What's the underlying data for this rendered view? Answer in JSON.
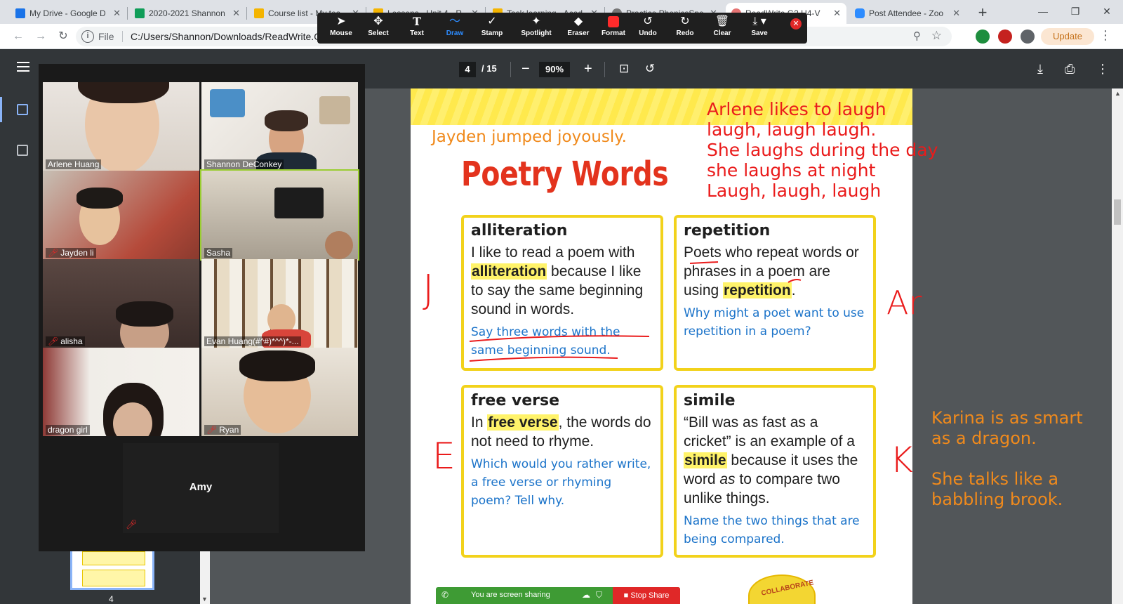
{
  "browser": {
    "tabs": [
      {
        "label": "My Drive - Google D",
        "favicon_color": "#1a73e8"
      },
      {
        "label": "2020-2021 Shannon",
        "favicon_color": "#0f9d58"
      },
      {
        "label": "Course list - My tea",
        "favicon_color": "#f4b400"
      },
      {
        "label": "Lessons - Unit 4 - R",
        "favicon_color": "#f4b400"
      },
      {
        "label": "Task learning - Acad",
        "favicon_color": "#f4b400"
      },
      {
        "label": "Practice PhonicsSpe",
        "favicon_color": "#777777"
      },
      {
        "label": "ReadWrite G2 U4-V",
        "favicon_color": "#e57373"
      },
      {
        "label": "Post Attendee - Zoo",
        "favicon_color": "#2d8cff"
      }
    ],
    "active_tab_index": 6,
    "url": "C:/Users/Shannon/Downloads/ReadWrite.G2.U4.V",
    "file_label": "File",
    "update_label": "Update"
  },
  "annotation_toolbar": {
    "tools": [
      {
        "label": "Mouse",
        "icon": "cursor-icon"
      },
      {
        "label": "Select",
        "icon": "move-icon"
      },
      {
        "label": "Text",
        "icon": "text-icon"
      },
      {
        "label": "Draw",
        "icon": "draw-icon"
      },
      {
        "label": "Stamp",
        "icon": "stamp-icon"
      },
      {
        "label": "Spotlight",
        "icon": "spotlight-icon"
      },
      {
        "label": "Eraser",
        "icon": "eraser-icon"
      },
      {
        "label": "Format",
        "icon": "format-icon"
      },
      {
        "label": "Undo",
        "icon": "undo-icon"
      },
      {
        "label": "Redo",
        "icon": "redo-icon"
      },
      {
        "label": "Clear",
        "icon": "trash-icon"
      },
      {
        "label": "Save",
        "icon": "save-icon"
      }
    ],
    "selected": "Draw",
    "accent": "#2d8cff"
  },
  "pdf_viewer": {
    "current_page": "4",
    "total_pages": "/ 15",
    "zoom": "90%",
    "thumbnail_page_number": "4"
  },
  "gallery": {
    "participants": [
      {
        "name": "Arlene Huang",
        "muted": false
      },
      {
        "name": "Shannon DeConkey",
        "muted": false
      },
      {
        "name": "Jayden li",
        "muted": true
      },
      {
        "name": "Sasha",
        "muted": false
      },
      {
        "name": "alisha",
        "muted": true
      },
      {
        "name": "Evan Huang(#^#)*^^)*-...",
        "muted": false
      },
      {
        "name": "dragon girl",
        "muted": false
      },
      {
        "name": "Ryan",
        "muted": true
      }
    ],
    "audio_only": {
      "name": "Amy",
      "muted": true
    }
  },
  "page": {
    "title": "Poetry Words",
    "cards": [
      {
        "heading": "alliteration",
        "prompt": "Say three words with the same beginning sound."
      },
      {
        "heading": "repetition",
        "prompt": "Why might a poet want to use repetition in a poem?"
      },
      {
        "heading": "free verse",
        "prompt": "Which would you rather write, a free verse or rhyming poem? Tell why."
      },
      {
        "heading": "simile",
        "prompt": "Name the two things that are being compared."
      }
    ],
    "body": {
      "alliteration": {
        "a": "I like to read a poem with",
        "b": "alliteration",
        "c": "because I like to say the same beginning sound in words."
      },
      "repetition": {
        "a": "Poets who repeat words or phrases in a poem are using",
        "b": "repetition",
        "c": "."
      },
      "free_verse": {
        "a": "In",
        "b": "free verse",
        "c": ", the words do not need to rhyme."
      },
      "simile": {
        "a": "“Bill was as fast as a cricket” is an example of a",
        "b": "simile",
        "c": "because it uses the word",
        "d": "as",
        "e": "to compare two unlike things."
      }
    },
    "collaborate_badge": "COLLABORATE"
  },
  "annotations": {
    "jayden": "Jayden jumped joyously.",
    "arlene": [
      "Arlene likes to laugh",
      "laugh, laugh laugh.",
      "She laughs during the day",
      "she laughs at night",
      "Laugh, laugh, laugh"
    ],
    "karina": [
      "Karina is as smart",
      "as a dragon.",
      "",
      "She talks like a",
      "babbling brook."
    ],
    "letters": {
      "j": "J",
      "ar": "Ar",
      "e": "E",
      "k": "K"
    },
    "pen_colors": {
      "red": "#ea1b1b",
      "orange": "#f08a1c"
    }
  },
  "share_bar": {
    "status": "You are screen sharing",
    "stop_label": "Stop Share"
  }
}
